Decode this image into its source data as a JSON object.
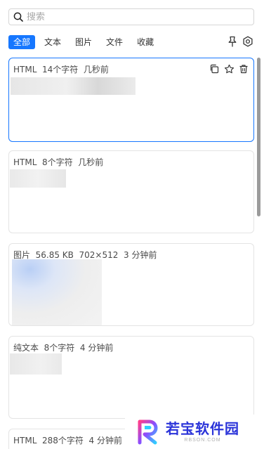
{
  "search": {
    "placeholder": "搜索"
  },
  "tabs": [
    {
      "label": "全部",
      "active": true
    },
    {
      "label": "文本",
      "active": false
    },
    {
      "label": "图片",
      "active": false
    },
    {
      "label": "文件",
      "active": false
    },
    {
      "label": "收藏",
      "active": false
    }
  ],
  "toolbar": {
    "pin_icon": "pin-icon",
    "settings_icon": "settings-icon"
  },
  "cards": [
    {
      "meta": "HTML  14个字符  几秒前",
      "actions": [
        "copy-icon",
        "star-icon",
        "trash-icon"
      ]
    },
    {
      "meta": "HTML  8个字符  几秒前"
    },
    {
      "meta": "图片  56.85 KB  702×512  3 分钟前"
    },
    {
      "meta": "纯文本  8个字符  4 分钟前"
    },
    {
      "meta": "HTML  288个字符  4 分钟前"
    }
  ],
  "watermark": {
    "title": "若宝软件园",
    "subtitle": "RBSON.COM"
  },
  "colors": {
    "accent": "#1677ff",
    "watermark": "#2b34d9"
  }
}
